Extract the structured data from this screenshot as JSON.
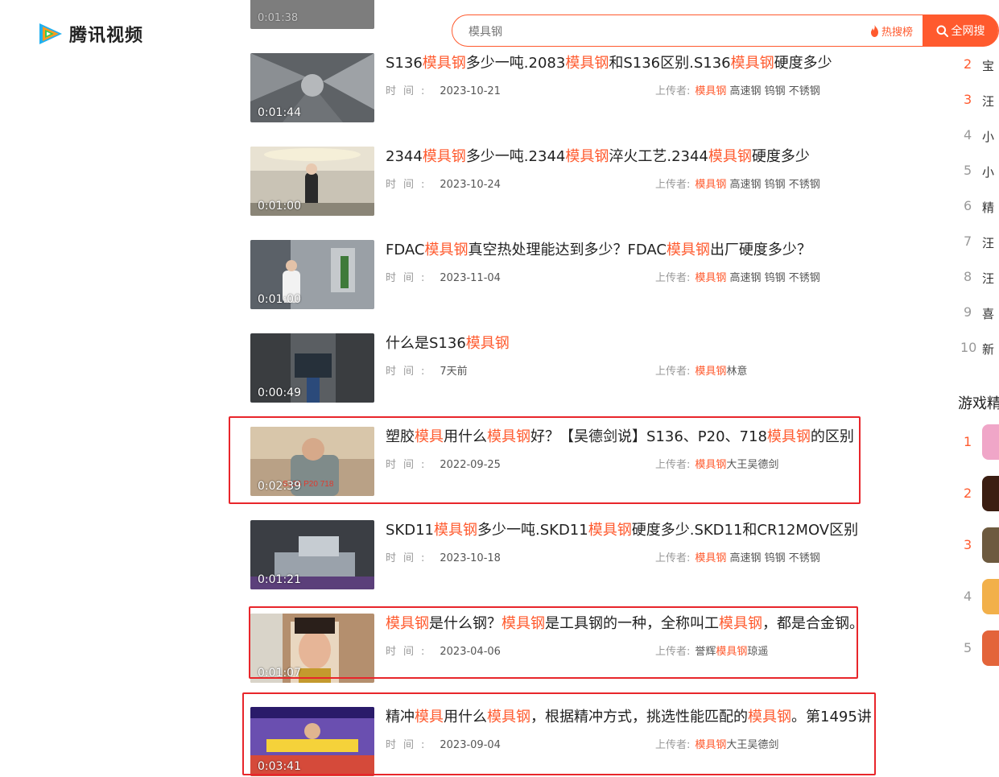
{
  "brand": {
    "name": "腾讯视频"
  },
  "search": {
    "query": "模具钢",
    "hot_label": "热搜榜",
    "all_label": "全网搜"
  },
  "top_partial": {
    "duration": "0:01:38"
  },
  "time_label": "时　间:",
  "uploader_label": "上传者:",
  "items": [
    {
      "duration": "0:01:44",
      "title": [
        [
          "S136",
          0
        ],
        [
          "模具钢",
          1
        ],
        [
          "多少一吨.2083",
          0
        ],
        [
          "模具钢",
          1
        ],
        [
          "和S136区别.S136",
          0
        ],
        [
          "模具钢",
          1
        ],
        [
          "硬度多少",
          0
        ]
      ],
      "date": "2023-10-21",
      "uploader": [
        [
          "模具钢",
          1
        ],
        [
          " 高速钢 钨钢 不锈钢",
          0
        ]
      ]
    },
    {
      "duration": "0:01:00",
      "title": [
        [
          "2344",
          0
        ],
        [
          "模具钢",
          1
        ],
        [
          "多少一吨.2344",
          0
        ],
        [
          "模具钢",
          1
        ],
        [
          "淬火工艺.2344",
          0
        ],
        [
          "模具钢",
          1
        ],
        [
          "硬度多少",
          0
        ]
      ],
      "date": "2023-10-24",
      "uploader": [
        [
          "模具钢",
          1
        ],
        [
          " 高速钢 钨钢 不锈钢",
          0
        ]
      ]
    },
    {
      "duration": "0:01:00",
      "title": [
        [
          "FDAC",
          0
        ],
        [
          "模具钢",
          1
        ],
        [
          "真空热处理能达到多少？FDAC",
          0
        ],
        [
          "模具钢",
          1
        ],
        [
          "出厂硬度多少？",
          0
        ]
      ],
      "date": "2023-11-04",
      "uploader": [
        [
          "模具钢",
          1
        ],
        [
          " 高速钢 钨钢 不锈钢",
          0
        ]
      ]
    },
    {
      "duration": "0:00:49",
      "title": [
        [
          "什么是S136",
          0
        ],
        [
          "模具钢",
          1
        ]
      ],
      "date": "7天前",
      "uploader": [
        [
          "模具钢",
          1
        ],
        [
          "林意",
          0
        ]
      ]
    },
    {
      "duration": "0:02:39",
      "title": [
        [
          "塑胶",
          0
        ],
        [
          "模具",
          1
        ],
        [
          "用什么",
          0
        ],
        [
          "模具钢",
          1
        ],
        [
          "好？【吴德剑说】S136、P20、718",
          0
        ],
        [
          "模具钢",
          1
        ],
        [
          "的区别",
          0
        ]
      ],
      "date": "2022-09-25",
      "uploader": [
        [
          "模具钢",
          1
        ],
        [
          "大王吴德剑",
          0
        ]
      ]
    },
    {
      "duration": "0:01:21",
      "title": [
        [
          "SKD11",
          0
        ],
        [
          "模具钢",
          1
        ],
        [
          "多少一吨.SKD11",
          0
        ],
        [
          "模具钢",
          1
        ],
        [
          "硬度多少.SKD11和CR12MOV区别",
          0
        ]
      ],
      "date": "2023-10-18",
      "uploader": [
        [
          "模具钢",
          1
        ],
        [
          " 高速钢 钨钢 不锈钢",
          0
        ]
      ]
    },
    {
      "duration": "0:01:07",
      "title": [
        [
          "模具钢",
          1
        ],
        [
          "是什么钢？",
          0
        ],
        [
          "模具钢",
          1
        ],
        [
          "是工具钢的一种，全称叫工",
          0
        ],
        [
          "模具钢",
          1
        ],
        [
          "，都是合金钢。",
          0
        ]
      ],
      "date": "2023-04-06",
      "uploader": [
        [
          "誉辉",
          0
        ],
        [
          "模具钢",
          1
        ],
        [
          "琼遥",
          0
        ]
      ]
    },
    {
      "duration": "0:03:41",
      "title": [
        [
          "精冲",
          0
        ],
        [
          "模具",
          1
        ],
        [
          "用什么",
          0
        ],
        [
          "模具钢",
          1
        ],
        [
          "，根据精冲方式，挑选性能匹配的",
          0
        ],
        [
          "模具钢",
          1
        ],
        [
          "。第1495讲",
          0
        ]
      ],
      "date": "2023-09-04",
      "uploader": [
        [
          "模具钢",
          1
        ],
        [
          "大王吴德剑",
          0
        ]
      ]
    }
  ],
  "hot_ranks": [
    {
      "num": "2",
      "text": "宝"
    },
    {
      "num": "3",
      "text": "汪"
    },
    {
      "num": "4",
      "text": "小"
    },
    {
      "num": "5",
      "text": "小"
    },
    {
      "num": "6",
      "text": "精"
    },
    {
      "num": "7",
      "text": "汪"
    },
    {
      "num": "8",
      "text": "汪"
    },
    {
      "num": "9",
      "text": "喜"
    },
    {
      "num": "10",
      "text": "新"
    }
  ],
  "game_section": {
    "title": "游戏精"
  },
  "game_ranks": [
    "1",
    "2",
    "3",
    "4",
    "5"
  ],
  "colors": {
    "accent": "#ff5a2e",
    "highlight_box": "#e8262b"
  }
}
